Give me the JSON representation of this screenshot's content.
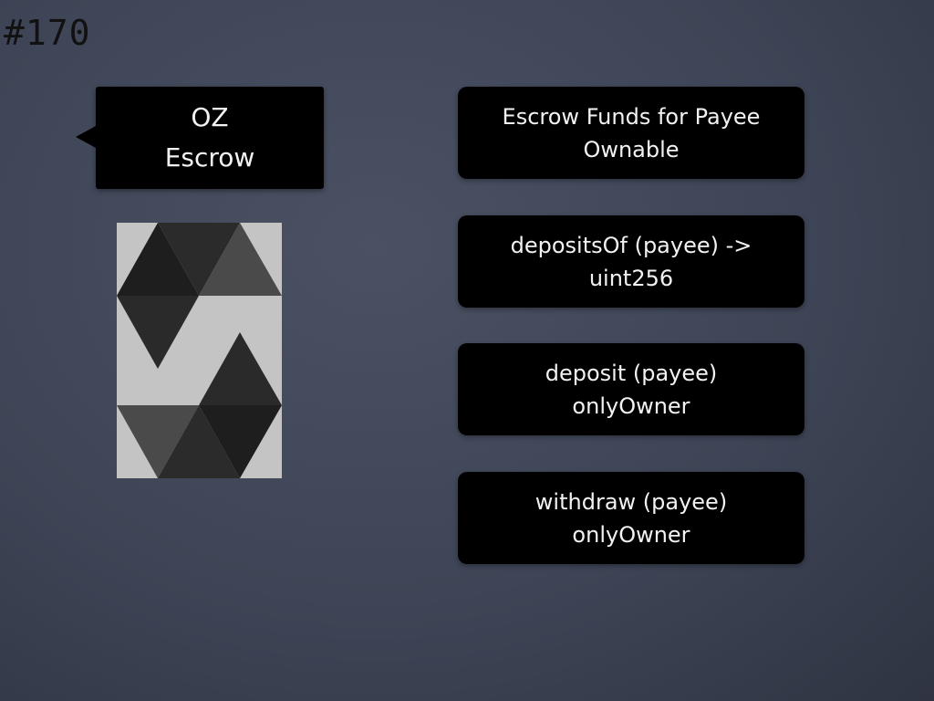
{
  "slide": {
    "number": "#170"
  },
  "callout": {
    "line1": "OZ",
    "line2": "Escrow"
  },
  "logo": {
    "name": "openzeppelin-logo-icon"
  },
  "boxes": [
    {
      "line1": "Escrow Funds for Payee",
      "line2": "Ownable"
    },
    {
      "line1": "depositsOf (payee) ->",
      "line2": "uint256"
    },
    {
      "line1": "deposit (payee)",
      "line2": "onlyOwner"
    },
    {
      "line1": "withdraw (payee)",
      "line2": "onlyOwner"
    }
  ],
  "colors": {
    "background": "#3e4556",
    "box": "#000000",
    "text": "#f2f2f2"
  }
}
